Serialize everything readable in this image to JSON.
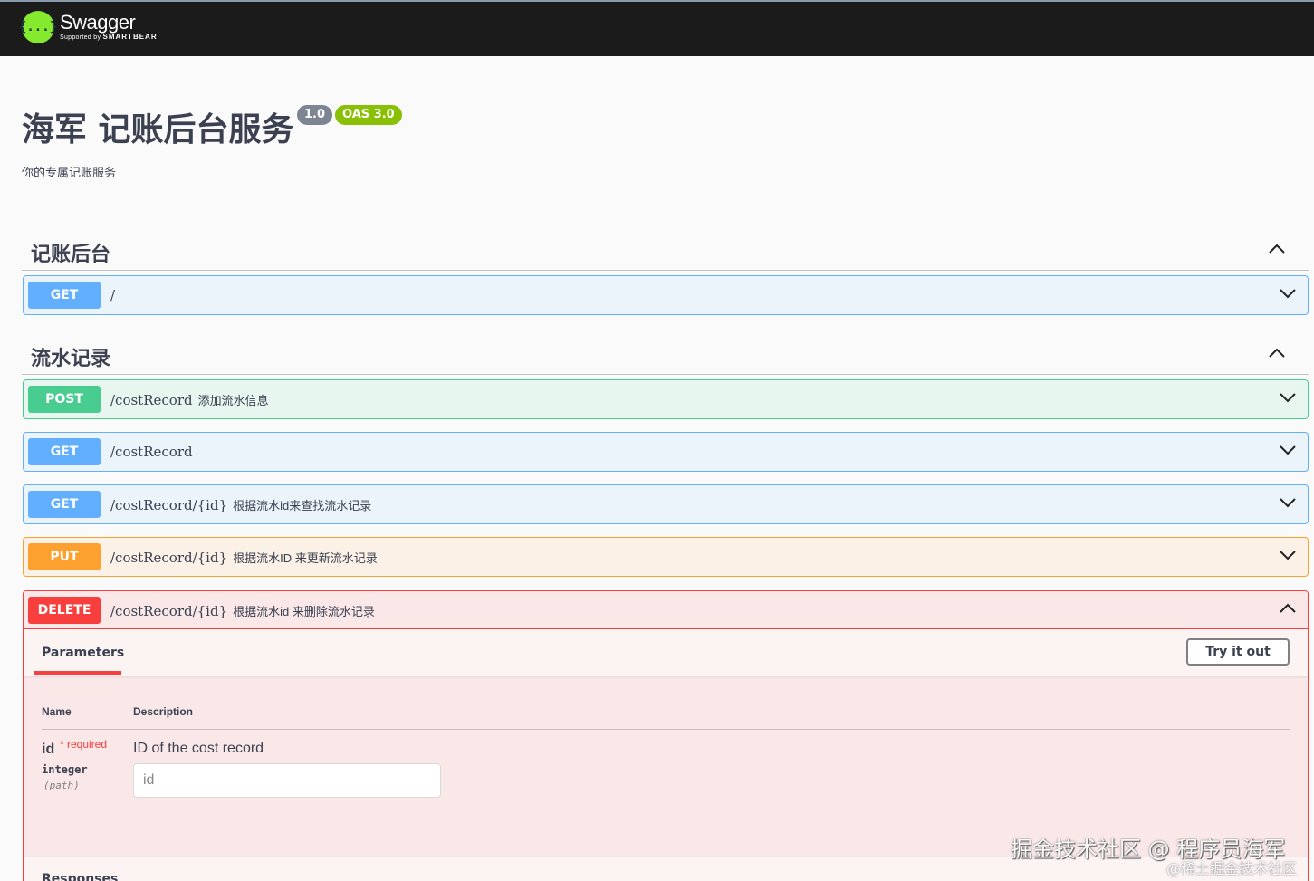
{
  "brand": {
    "name": "Swagger",
    "sub_prefix": "Supported by",
    "sub_brand": "SMARTBEAR",
    "logo_glyph": "{...}"
  },
  "info": {
    "title": "海军 记账后台服务",
    "version": "1.0",
    "oas": "OAS 3.0",
    "description": "你的专属记账服务"
  },
  "tags": [
    {
      "name": "记账后台",
      "operations": [
        {
          "method": "GET",
          "path": "/",
          "summary": ""
        }
      ]
    },
    {
      "name": "流水记录",
      "operations": [
        {
          "method": "POST",
          "path": "/costRecord",
          "summary": "添加流水信息"
        },
        {
          "method": "GET",
          "path": "/costRecord",
          "summary": ""
        },
        {
          "method": "GET",
          "path": "/costRecord/{id}",
          "summary": "根据流水id来查找流水记录"
        },
        {
          "method": "PUT",
          "path": "/costRecord/{id}",
          "summary": "根据流水ID 来更新流水记录"
        },
        {
          "method": "DELETE",
          "path": "/costRecord/{id}",
          "summary": "根据流水id 来删除流水记录"
        }
      ]
    }
  ],
  "expanded": {
    "parameters_tab": "Parameters",
    "try_button": "Try it out",
    "col_name": "Name",
    "col_description": "Description",
    "param": {
      "name": "id",
      "required_mark": "* required",
      "type": "integer",
      "in": "(path)",
      "description": "ID of the cost record",
      "placeholder": "id"
    },
    "responses_title": "Responses"
  },
  "watermark": {
    "line1": "掘金技术社区 @ 程序员海军",
    "line2": "@稀土掘金技术社区"
  },
  "colors": {
    "get": "#61affe",
    "post": "#49cc90",
    "put": "#fca130",
    "delete": "#f93e3e",
    "logo": "#85ea2d"
  },
  "icons": {
    "collapse": "chevron-up-icon",
    "expand": "chevron-down-icon"
  }
}
